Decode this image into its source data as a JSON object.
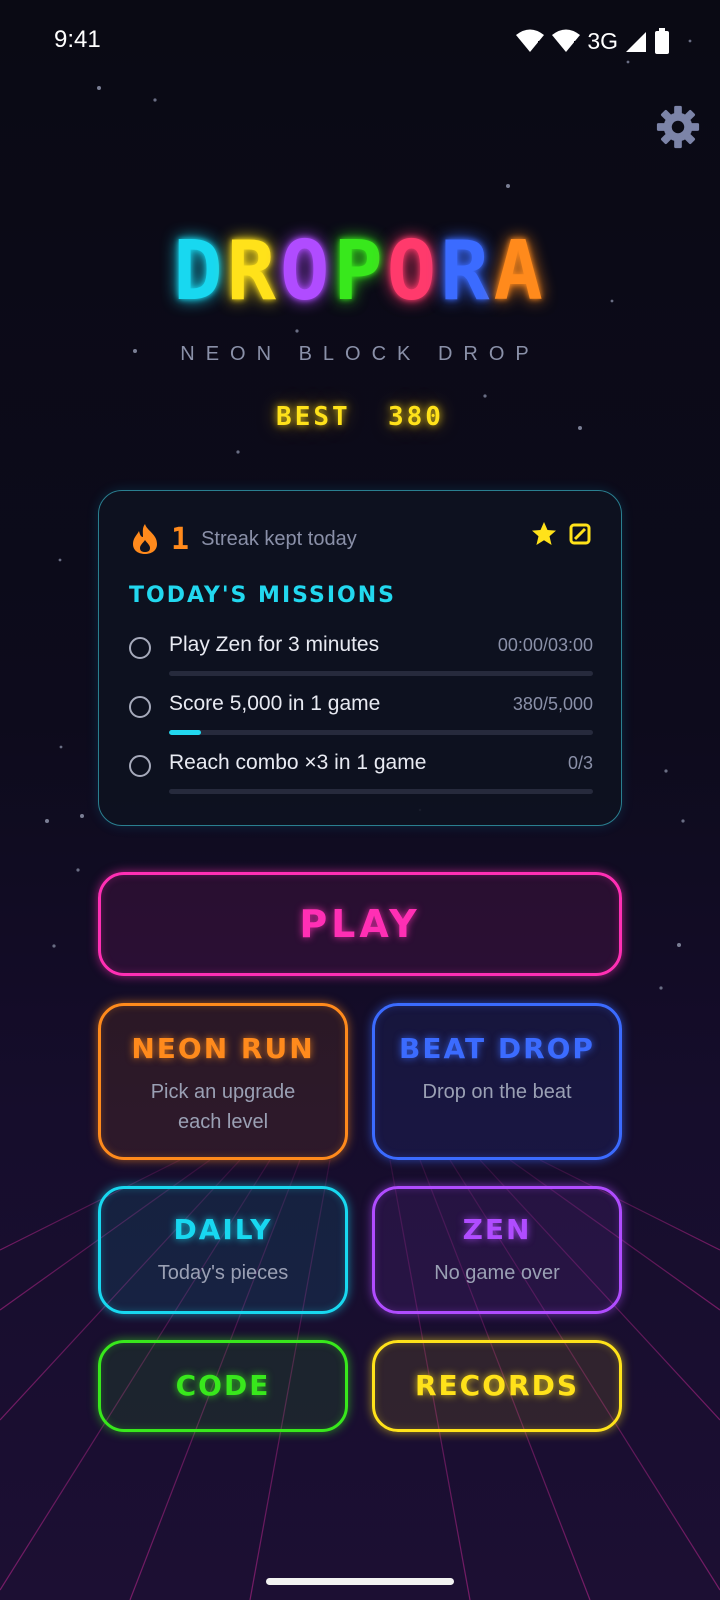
{
  "status_bar": {
    "time": "9:41",
    "network": "3G"
  },
  "header": {
    "title_letters": [
      {
        "char": "D",
        "color": "#18d8f0"
      },
      {
        "char": "R",
        "color": "#ffe21a"
      },
      {
        "char": "O",
        "color": "#b04cff"
      },
      {
        "char": "P",
        "color": "#38e81c"
      },
      {
        "char": "O",
        "color": "#ff3a6c"
      },
      {
        "char": "R",
        "color": "#3b6bff"
      },
      {
        "char": "A",
        "color": "#ff8a1c"
      }
    ],
    "subtitle": "NEON BLOCK DROP",
    "best_label": "BEST",
    "best_score": "380",
    "best_text": "BEST  380"
  },
  "missions_card": {
    "streak_count": "1",
    "streak_text": "Streak kept today",
    "heading": "TODAY'S MISSIONS",
    "missions": [
      {
        "label": "Play Zen for 3 minutes",
        "value": "00:00/03:00",
        "progress": 0.0
      },
      {
        "label": "Score 5,000 in 1 game",
        "value": "380/5,000",
        "progress": 0.076
      },
      {
        "label": "Reach combo ×3 in 1 game",
        "value": "0/3",
        "progress": 0.0
      }
    ]
  },
  "menu": {
    "play": {
      "label": "PLAY",
      "color": "#ff2fb4"
    },
    "neon_run": {
      "label": "NEON RUN",
      "sub": "Pick an upgrade each level",
      "color": "#ff8a1c"
    },
    "beat_drop": {
      "label": "BEAT DROP",
      "sub": "Drop on the beat",
      "color": "#3b6bff"
    },
    "daily": {
      "label": "DAILY",
      "sub": "Today's pieces",
      "color": "#18d8f0"
    },
    "zen": {
      "label": "ZEN",
      "sub": "No game over",
      "color": "#b04cff"
    },
    "code": {
      "label": "CODE",
      "color": "#38e81c"
    },
    "records": {
      "label": "RECORDS",
      "color": "#ffe21a"
    }
  },
  "icons": [
    "wifi-icon",
    "wifi-icon",
    "signal-icon",
    "battery-icon",
    "gear-icon",
    "flame-icon",
    "star-icon",
    "ticket-icon",
    "circle-icon"
  ]
}
